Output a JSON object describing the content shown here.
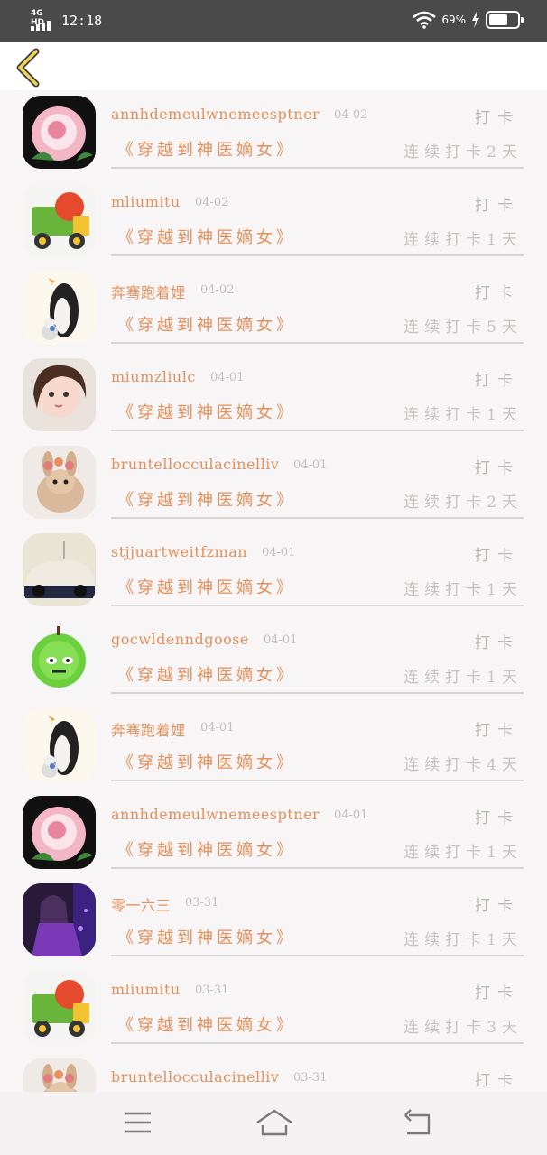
{
  "status_bar": {
    "network": "4G HD",
    "time": "12:18",
    "battery_percent": "69%",
    "icons": [
      "signal-icon",
      "wifi-icon",
      "charging-icon",
      "battery-icon"
    ]
  },
  "header": {
    "back_icon": "chevron-left-icon",
    "accent_color": "#e2915d"
  },
  "list": {
    "items": [
      {
        "name": "annhdemeulwnemeesptner",
        "date": "04-02",
        "action": "打卡",
        "book": "《穿越到神医嫡女》",
        "streak": "连续打卡2天",
        "avatar": "rose"
      },
      {
        "name": "mliumitu",
        "date": "04-02",
        "action": "打卡",
        "book": "《穿越到神医嫡女》",
        "streak": "连续打卡1天",
        "avatar": "truck"
      },
      {
        "name": "奔骞跑着娌",
        "date": "04-02",
        "action": "打卡",
        "book": "《穿越到神医嫡女》",
        "streak": "连续打卡5天",
        "avatar": "penguin"
      },
      {
        "name": "miumzliulc",
        "date": "04-01",
        "action": "打卡",
        "book": "《穿越到神医嫡女》",
        "streak": "连续打卡1天",
        "avatar": "girl"
      },
      {
        "name": "bruntellocculacinelliv",
        "date": "04-01",
        "action": "打卡",
        "book": "《穿越到神医嫡女》",
        "streak": "连续打卡2天",
        "avatar": "bunny"
      },
      {
        "name": "stjjuartweitfzman",
        "date": "04-01",
        "action": "打卡",
        "book": "《穿越到神医嫡女》",
        "streak": "连续打卡1天",
        "avatar": "car"
      },
      {
        "name": "gocwldenndgoose",
        "date": "04-01",
        "action": "打卡",
        "book": "《穿越到神医嫡女》",
        "streak": "连续打卡1天",
        "avatar": "apple"
      },
      {
        "name": "奔骞跑着娌",
        "date": "04-01",
        "action": "打卡",
        "book": "《穿越到神医嫡女》",
        "streak": "连续打卡4天",
        "avatar": "penguin"
      },
      {
        "name": "annhdemeulwnemeesptner",
        "date": "04-01",
        "action": "打卡",
        "book": "《穿越到神医嫡女》",
        "streak": "连续打卡1天",
        "avatar": "rose"
      },
      {
        "name": "零一六三",
        "date": "03-31",
        "action": "打卡",
        "book": "《穿越到神医嫡女》",
        "streak": "连续打卡1天",
        "avatar": "anime"
      },
      {
        "name": "mliumitu",
        "date": "03-31",
        "action": "打卡",
        "book": "《穿越到神医嫡女》",
        "streak": "连续打卡3天",
        "avatar": "truck"
      },
      {
        "name": "bruntellocculacinelliv",
        "date": "03-31",
        "action": "打卡",
        "book": "",
        "streak": "",
        "avatar": "bunny"
      }
    ]
  },
  "nav_bar": {
    "buttons": [
      "menu-icon",
      "home-icon",
      "back-icon"
    ]
  }
}
